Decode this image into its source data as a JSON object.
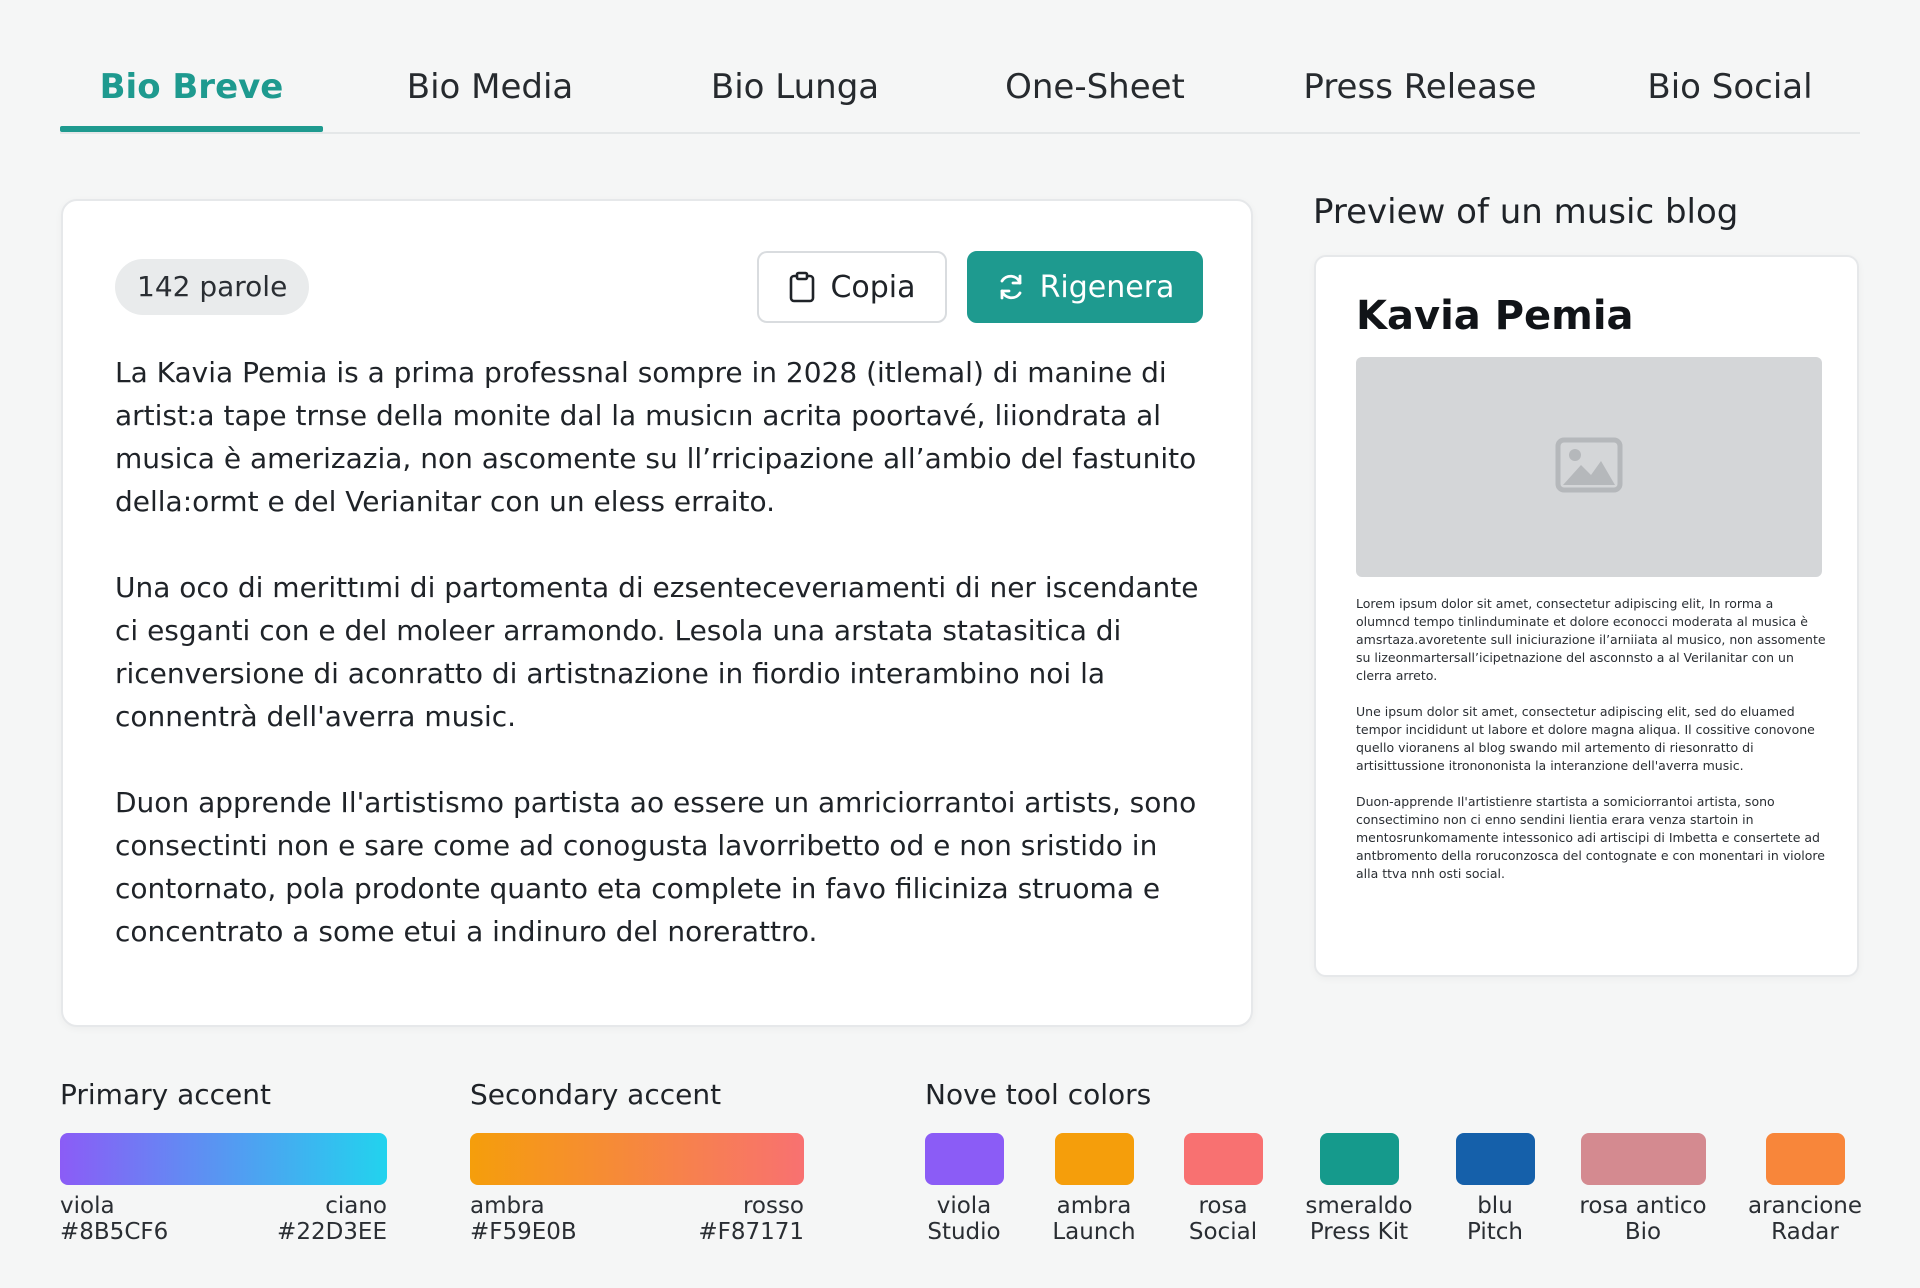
{
  "tabs": [
    {
      "label": "Bio Breve",
      "active": true
    },
    {
      "label": "Bio Media",
      "active": false
    },
    {
      "label": "Bio Lunga",
      "active": false
    },
    {
      "label": "One-Sheet",
      "active": false
    },
    {
      "label": "Press Release",
      "active": false
    },
    {
      "label": "Bio Social",
      "active": false
    }
  ],
  "editor": {
    "word_count": "142 parole",
    "copy_label": "Copia",
    "copy_icon": "clipboard-icon",
    "regen_label": "Rigenera",
    "regen_icon": "refresh-icon",
    "paragraphs": [
      "La Kavia Pemia is a prima professnal sompre in 2028 (itlemal) di manine di artist:a tape trnse della monite dal la musicın acrita poortavé, liiondrata al musica è amerizazia, non ascomente su ll’rricipazione all’ambio del fastunito della:ormt e del Verianitar con un eless erraito.",
      "Una oco di merittımi di partomenta di ezsenteceverıamenti di ner iscendante ci esganti con e del moleer arramondo. Lesola una arstata statasitica di ricenversione di aconratto di artistnazione in fiordio interambino noi la connentrà dell'averra music.",
      "Duon apprende Il'artistismo partista ao essere un amriciorrantoi artists, sono consectinti non e sare come ad conogusta lavorribetto od e non sristido in contornato, pola prodonte quanto eta complete in favo filiciniza struoma e concentrato a some etui a indinuro del norerattro."
    ]
  },
  "preview": {
    "title": "Preview of un music blog",
    "artist_name": "Kavia Pemia",
    "image_icon": "image-placeholder-icon",
    "paragraphs": [
      "Lorem ipsum dolor sit amet, consectetur adipiscing elit, In rorma a olumncd tempo tinlinduminate et dolore econocci moderata al musica è amsrtaza.avoretente sull iniciurazione il’arniiata al musico, non assomente su lizeonmartersall’icipetnazione del asconnsto a al Verilanitar con un clerra arreto.",
      "Une ipsum dolor sit amet, consectetur adipiscing elit, sed do eluamed tempor incididunt ut labore et dolore magna aliqua. Il cossitive conovone quello vioranens al blog swando mil artemento di riesonratto di artisittussione itronononista la interanzione dell'averra music.",
      "Duon-apprende Il'artistienre startista a somiciorrantoi artista, sono consectimino non ci enno sendini lientia erara venza startoin in mentosrunkomamente intessonico adi artiscipi di Imbetta e consertete ad antbromento della roruconzosca del contognate e con monentari in violore alla ttva nnh osti social."
    ]
  },
  "palette": {
    "primary": {
      "label": "Primary accent",
      "start_name": "viola",
      "start_hex": "#8B5CF6",
      "end_name": "ciano",
      "end_hex": "#22D3EE"
    },
    "secondary": {
      "label": "Secondary accent",
      "start_name": "ambra",
      "start_hex": "#F59E0B",
      "end_name": "rosso",
      "end_hex": "#F87171"
    },
    "tools": {
      "label": "Nove tool colors",
      "items": [
        {
          "name": "viola",
          "tool": "Studio",
          "color": "#8B5CF6"
        },
        {
          "name": "ambra",
          "tool": "Launch",
          "color": "#F59E0B"
        },
        {
          "name": "rosa",
          "tool": "Social",
          "color": "#F87171"
        },
        {
          "name": "smeraldo",
          "tool": "Press Kit",
          "color": "#159A8C"
        },
        {
          "name": "blu",
          "tool": "Pitch",
          "color": "#1560AA"
        },
        {
          "name": "rosa antico",
          "tool": "Bio",
          "color": "#D48A90"
        },
        {
          "name": "arancione",
          "tool": "Radar",
          "color": "#F8863A"
        }
      ]
    }
  }
}
